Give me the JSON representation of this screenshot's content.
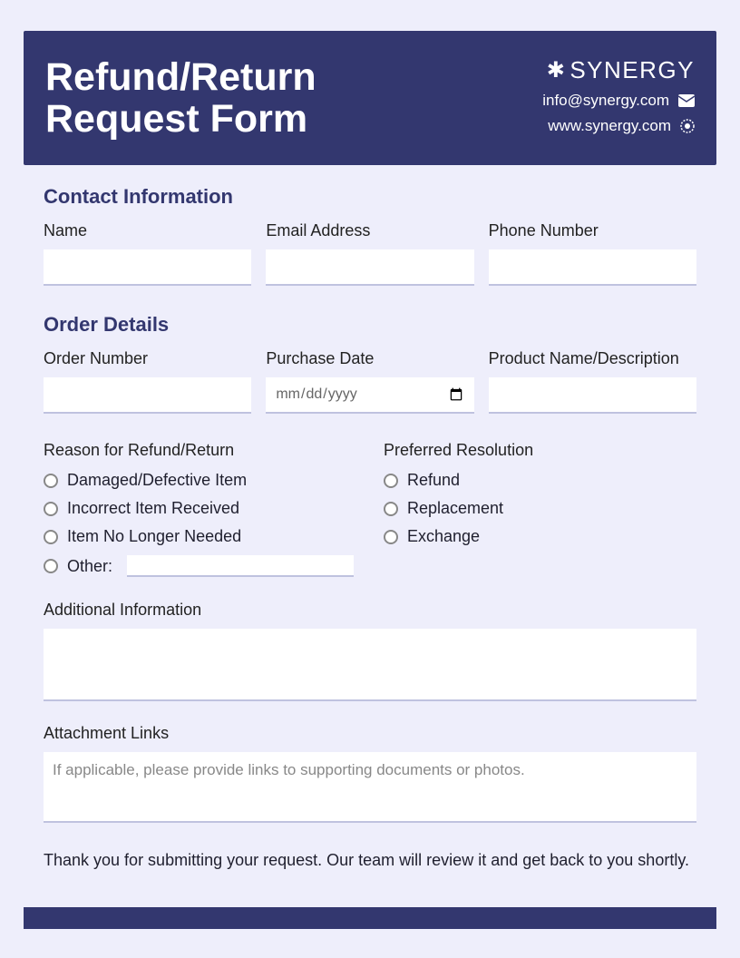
{
  "header": {
    "title_line1": "Refund/Return",
    "title_line2": "Request Form",
    "brand": "SYNERGY",
    "email": "info@synergy.com",
    "website": "www.synergy.com"
  },
  "sections": {
    "contact": {
      "title": "Contact Information",
      "name_label": "Name",
      "email_label": "Email Address",
      "phone_label": "Phone Number"
    },
    "order": {
      "title": "Order Details",
      "order_number_label": "Order Number",
      "purchase_date_label": "Purchase Date",
      "date_placeholder": "mm/dd/yyyy",
      "product_label": "Product Name/Description",
      "reason_label": "Reason for Refund/Return",
      "reasons": {
        "damaged": "Damaged/Defective Item",
        "incorrect": "Incorrect Item Received",
        "not_needed": "Item No Longer Needed",
        "other": "Other:"
      },
      "resolution_label": "Preferred Resolution",
      "resolutions": {
        "refund": "Refund",
        "replacement": "Replacement",
        "exchange": "Exchange"
      },
      "additional_label": "Additional Information",
      "attachment_label": "Attachment Links",
      "attachment_placeholder": "If applicable, please provide links to supporting documents or photos."
    }
  },
  "footer": {
    "message": "Thank you for submitting your request. Our team will review it and get back to you shortly."
  }
}
